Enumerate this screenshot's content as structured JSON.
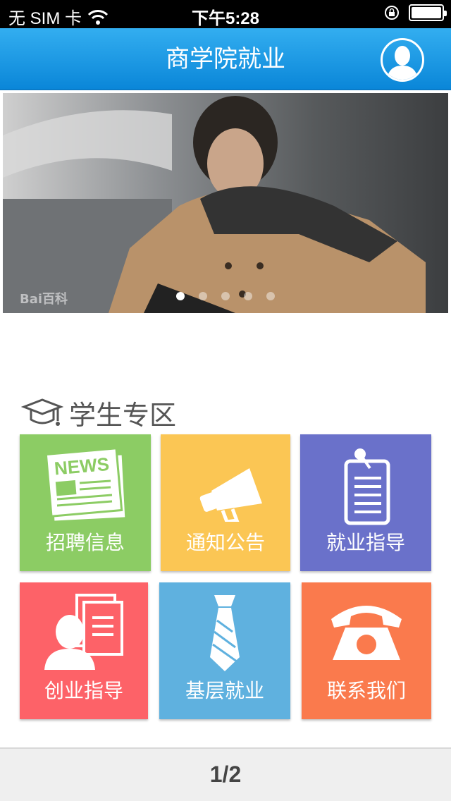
{
  "status_bar": {
    "carrier": "无 SIM 卡",
    "time": "下午5:28"
  },
  "header": {
    "title": "商学院就业"
  },
  "banner": {
    "watermark": "Bai百科",
    "page_count": 5,
    "active_page": 0
  },
  "section": {
    "title": "学生专区"
  },
  "tiles": [
    {
      "label": "招聘信息",
      "color": "#8ccc64",
      "icon": "news-icon"
    },
    {
      "label": "通知公告",
      "color": "#fbc654",
      "icon": "megaphone-icon"
    },
    {
      "label": "就业指导",
      "color": "#6a71ca",
      "icon": "clipboard-icon"
    },
    {
      "label": "创业指导",
      "color": "#fd6268",
      "icon": "person-document-icon"
    },
    {
      "label": "基层就业",
      "color": "#5fb1df",
      "icon": "tie-icon"
    },
    {
      "label": "联系我们",
      "color": "#fa7a4d",
      "icon": "telephone-icon"
    }
  ],
  "pager": {
    "label": "1/2"
  }
}
